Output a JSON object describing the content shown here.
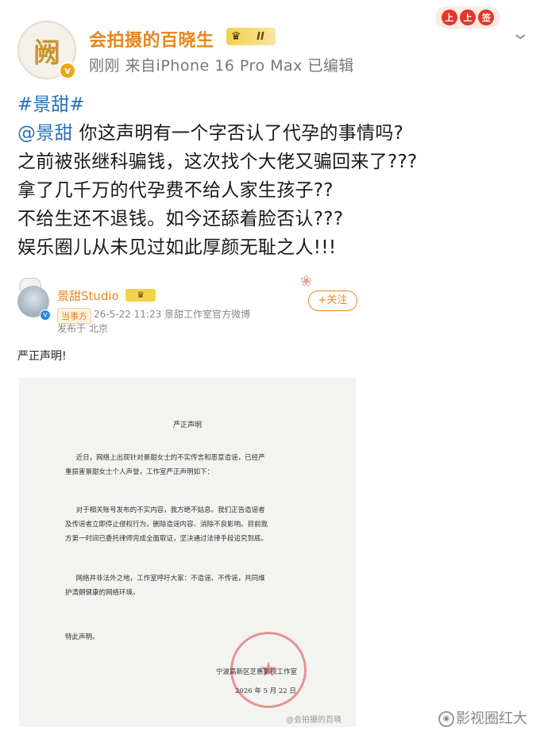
{
  "post": {
    "author": "会拍摄的百晓生",
    "badge_level": "II",
    "avatar_glyph": "阙",
    "meta": "刚刚  来自iPhone 16 Pro Max  已编辑",
    "hashtag": "#景甜#",
    "mention": "@景甜",
    "lines": [
      " 你这声明有一个字否认了代孕的事情吗?",
      "之前被张继科骗钱，这次找个大佬又骗回来了???",
      "拿了几千万的代孕费不给人家生孩子??",
      "不给生还不退钱。如今还舔着脸否认???",
      "娱乐圈儿从未见过如此厚颜无耻之人!!!"
    ]
  },
  "quoted": {
    "author": "景甜Studio",
    "tag": "当事方",
    "meta": "26-5-22 11:23  景甜工作室官方微博",
    "location": "发布于 北京",
    "follow_label": "+关注",
    "text": "严正声明!",
    "document": {
      "title": "严正声明",
      "paragraphs": [
        [
          "近日，网络上出现针对景甜女士的不实传言和恶意造谣，已经严",
          "重损害景甜女士个人声誉，工作室严正声明如下："
        ],
        [
          "对于相关账号发布的不实内容，我方绝不姑息。我们正告造谣者",
          "及传谣者立即停止侵权行为，删除造谣内容、消除不良影响。目前我",
          "方第一时间已委托律师完成全面取证，坚决通过法律手段追究到底。"
        ],
        [
          "网络并非法外之地，工作室呼吁大家：不造谣、不传谣，共同维",
          "护清朗健康的网络环境。"
        ],
        [
          "特此声明。"
        ]
      ],
      "signature": "宁波高新区芝惠影视工作室",
      "date": "2026 年 5 月 22 日"
    }
  },
  "watermarks": {
    "small": "@会拍摄的百晓",
    "large": "影视圈红大"
  },
  "colors": {
    "username": "#e8861f",
    "link": "#2a6fb5",
    "meta": "#777777"
  }
}
